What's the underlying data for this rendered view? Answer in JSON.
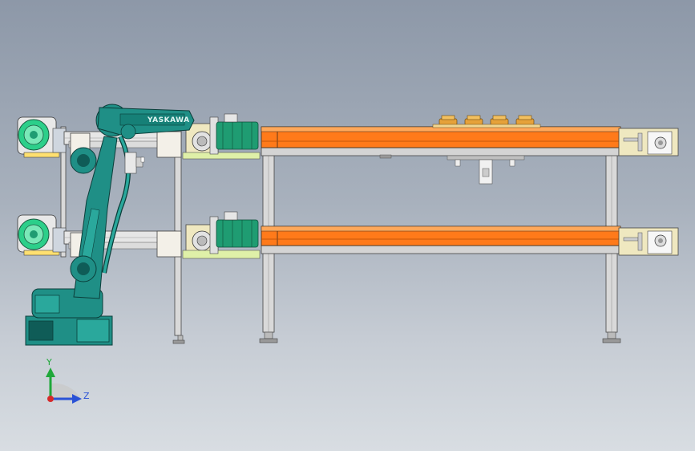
{
  "robot": {
    "brand_text": "YASKAWA",
    "body_color": "#1f8f86",
    "accent_color": "#0f5c57"
  },
  "conveyor": {
    "belt_color": "#ff7a1a",
    "frame_color": "#c8c8c8",
    "plate_color": "#efe8c0",
    "motor_color": "#1f9c72"
  },
  "triad": {
    "y_label": "Y",
    "z_label": "Z",
    "y_color": "#1fa83a",
    "z_color": "#2a52d6",
    "x_color": "#d62a2a"
  }
}
